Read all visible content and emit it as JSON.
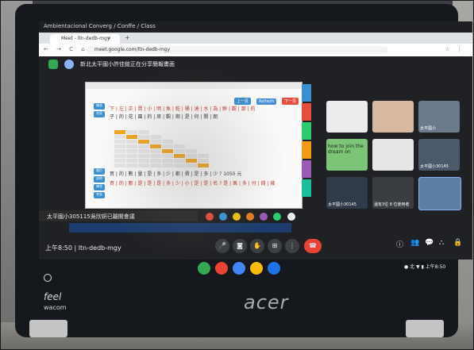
{
  "os_topbar": {
    "text": "Ambientacional Converg / Conffe / Class"
  },
  "browser": {
    "tab_title": "Meet - ltn-dedb-mgy",
    "tab_close": "×",
    "tab_new": "+",
    "nav_icons": "← → C ⌂",
    "url": "meet.google.com/ltn-dedb-mgy",
    "tool_icons": "☆ ⋮"
  },
  "meet": {
    "presenter_text": "新北太平國小許佳鋐正在分享簡報畫面",
    "meeting_time": "上午8:50",
    "meeting_code": "ltn-dedb-mgy",
    "notification": "太平國小305115吳欣妍已離開會議",
    "tiles": [
      {
        "label": "",
        "color": "#ececec"
      },
      {
        "label": "",
        "color": "#d9b8a2"
      },
      {
        "label": "太平國小",
        "color": "#6b7b8c"
      },
      {
        "label": "how to join the dream on",
        "color": "#7cc576"
      },
      {
        "label": "",
        "color": "#e6e6e6"
      },
      {
        "label": "太平國小30145",
        "color": "#4a5a6b"
      },
      {
        "label": "太平國小30145",
        "color": "#2f3b4a"
      },
      {
        "label": "還有3位 8 位使用者",
        "color": "#3a3d42"
      },
      {
        "label": "",
        "color": "#5d7ea3"
      }
    ],
    "status_tray": "● 北 ▼ ▮ 上午8:50"
  },
  "slide": {
    "buttons": [
      "上一頁",
      "Refresh",
      "下一頁"
    ],
    "button_colors": [
      "#3b8ed0",
      "#4a90d9",
      "#e74c3c"
    ],
    "line1": "下 | 左 | 正 | 賣 | 小 | 明 | 魚 | 乾 | 桶 | 澆 | 水 | 為 | 鮮 | 觀 | 那 | 的",
    "line2": "子 | 的 | 花 | 園 | 的 | 來 | 觀 | 期 | 是 | 何 | 開 | 朗",
    "line3": "買 | 的 | 數 | 量 | 是 | 多 | 少 | 都 | 費 | 是 | 多 | 少 ? 1050 元",
    "line4": "買 | 的 | 數 | 是 | 是 | 是 | 多 | 少 | 小 | 是 | 是 | 名 ? 是 | 萬 | 多 | 付 | 錢 | 幾",
    "left_tags": [
      "練習",
      "答案",
      "題目",
      "說明",
      "練習",
      "答案"
    ],
    "side_tab_colors": [
      "#3b8ed0",
      "#e74c3c",
      "#2ecc71",
      "#f39c12",
      "#9b59b6",
      "#1abc9c",
      "#e67e22",
      "#34495e"
    ]
  },
  "brand": {
    "laptop": "acer",
    "pen_logo": "feel",
    "pen_brand": "wacom"
  }
}
